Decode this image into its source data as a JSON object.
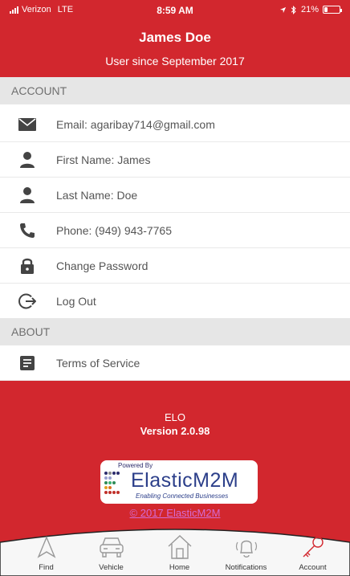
{
  "status_bar": {
    "carrier": "Verizon",
    "network": "LTE",
    "time": "8:59 AM",
    "battery": "21%",
    "battery_level": 0.21
  },
  "profile": {
    "name": "James Doe",
    "since": "User since September 2017"
  },
  "account_section": {
    "title": "ACCOUNT",
    "items": [
      {
        "label": "Email:  agaribay714@gmail.com",
        "icon": "envelope-icon"
      },
      {
        "label": "First Name:  James",
        "icon": "person-icon"
      },
      {
        "label": "Last Name:  Doe",
        "icon": "person-icon"
      },
      {
        "label": "Phone:  (949) 943-7765",
        "icon": "phone-icon"
      },
      {
        "label": "Change Password",
        "icon": "lock-icon"
      },
      {
        "label": "Log Out",
        "icon": "logout-icon"
      }
    ]
  },
  "about_section": {
    "title": "ABOUT",
    "items": [
      {
        "label": "Terms of Service",
        "icon": "document-icon"
      }
    ]
  },
  "footer": {
    "app_name": "ELO",
    "version": "Version 2.0.98",
    "logo": {
      "powered_by": "Powered By",
      "brand": "ElasticM2M",
      "tagline": "Enabling Connected Businesses"
    },
    "copyright": "© 2017 ElasticM2M"
  },
  "tabs": [
    {
      "label": "Find",
      "icon": "compass-icon",
      "active": false
    },
    {
      "label": "Vehicle",
      "icon": "car-icon",
      "active": false
    },
    {
      "label": "Home",
      "icon": "house-icon",
      "active": false
    },
    {
      "label": "Notifications",
      "icon": "bell-icon",
      "active": false
    },
    {
      "label": "Account",
      "icon": "key-icon",
      "active": true
    }
  ],
  "colors": {
    "brand_red": "#d2272e",
    "active_tab": "#d2272e",
    "section_bg": "#e6e6e6"
  }
}
